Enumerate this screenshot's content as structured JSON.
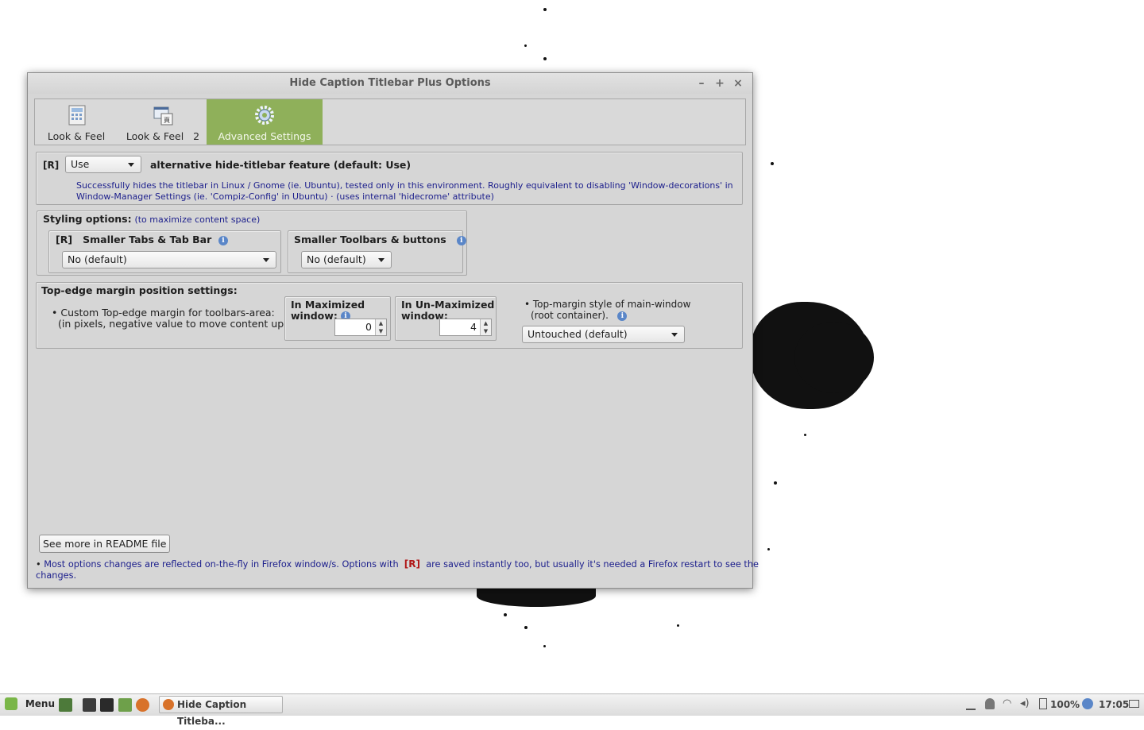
{
  "window": {
    "title": "Hide Caption Titlebar Plus Options",
    "minimize": "–",
    "maximize": "+",
    "close": "×"
  },
  "tabs": [
    {
      "label": "Look & Feel",
      "icon": "calculator-icon"
    },
    {
      "label": "Look & Feel",
      "badge": "2",
      "icon": "window-page-icon"
    },
    {
      "label": "Advanced Settings",
      "icon": "gear-icon",
      "active": true
    }
  ],
  "alt_feature": {
    "tag": "[R]",
    "value": "Use",
    "title": "alternative hide-titlebar feature (default: Use)",
    "desc_line1": "Successfully hides the titlebar in Linux / Gnome (ie. Ubuntu), tested only in this environment. Roughly equivalent to disabling 'Window-decorations' in",
    "desc_line2": "Window-Manager Settings (ie. 'Compiz-Config' in Ubuntu) · (uses internal 'hidecrome' attribute)"
  },
  "styling": {
    "title": "Styling options:",
    "subtitle": "(to maximize content space)",
    "tabs_tag": "[R]",
    "tabs_label": "Smaller Tabs & Tab Bar",
    "tabs_value": "No (default)",
    "toolbars_label": "Smaller Toolbars & buttons",
    "toolbars_value": "No (default)"
  },
  "margin": {
    "title": "Top-edge margin position settings:",
    "bullet1_line1": "• Custom Top-edge margin for toolbars-area:",
    "bullet1_line2": "(in pixels, negative value to move content up)",
    "max_label_line1": "In Maximized",
    "max_label_line2": "window:",
    "max_value": "0",
    "unmax_label_line1": "In Un-Maximized",
    "unmax_label_line2": "window:",
    "unmax_value": "4",
    "style_line1": "• Top-margin style of main-window",
    "style_line2": "(root container).",
    "style_value": "Untouched (default)"
  },
  "footer": {
    "readme_button": "See more in README file",
    "note_prefix": "• ",
    "note_part1": "Most options changes are reflected on-the-fly in Firefox window/s. Options with",
    "note_tag": "[R]",
    "note_part2": "are saved instantly too, but usually it's needed a Firefox restart to see the",
    "note_part3": "changes."
  },
  "taskbar": {
    "menu_label": "Menu",
    "window_label": "Hide Caption Titleba...",
    "battery": "100%",
    "clock": "17:05"
  },
  "colors": {
    "active_tab": "#8fb05a",
    "info_blue": "#1b1e8c",
    "tag_red": "#b01818"
  }
}
